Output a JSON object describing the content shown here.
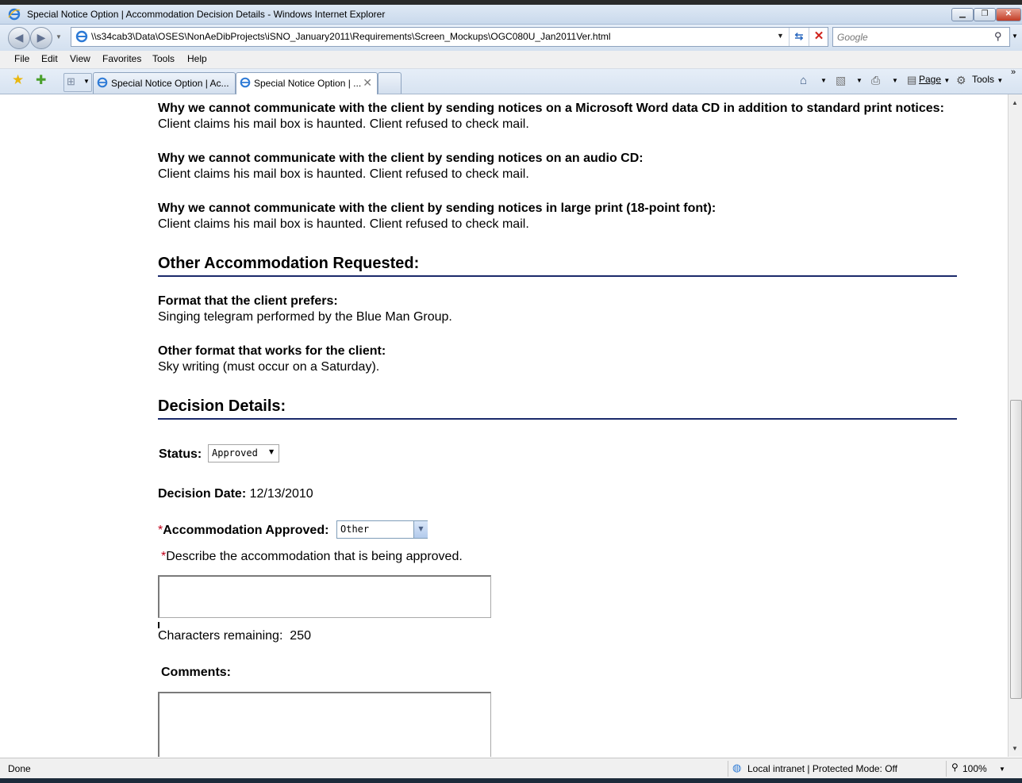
{
  "window": {
    "title": "Special Notice Option | Accommodation Decision Details - Windows Internet Explorer",
    "minimize_label": "▁",
    "restore_label": "❐",
    "close_label": "✕"
  },
  "address_bar": {
    "url": "\\\\s34cab3\\Data\\OSES\\NonAeDibProjects\\iSNO_January2011\\Requirements\\Screen_Mockups\\OGC080U_Jan2011Ver.html",
    "search_placeholder": "Google"
  },
  "menu": [
    "File",
    "Edit",
    "View",
    "Favorites",
    "Tools",
    "Help"
  ],
  "tabs": [
    {
      "label": "Special Notice Option | Ac..."
    },
    {
      "label": "Special Notice Option | ..."
    }
  ],
  "command_bar": {
    "page_label": "Page",
    "tools_label": "Tools"
  },
  "content": {
    "reasons": [
      {
        "question": "Why we cannot communicate with the client by sending notices on a Microsoft Word data CD in addition to standard print notices:",
        "answer": "Client claims his mail box is haunted. Client refused to check mail."
      },
      {
        "question": "Why we cannot communicate with the client by sending notices on an audio CD:",
        "answer": "Client claims his mail box is haunted. Client refused to check mail."
      },
      {
        "question": "Why we cannot communicate with the client by sending notices in large print (18-point font):",
        "answer": "Client claims his mail box is haunted. Client refused to check mail."
      }
    ],
    "other_accommodation": {
      "heading": "Other Accommodation Requested:",
      "preferred_label": "Format that the client prefers:",
      "preferred_value": "Singing telegram performed by the Blue Man Group.",
      "other_label": "Other format that works for the client:",
      "other_value": "Sky writing (must occur on a Saturday)."
    },
    "decision": {
      "heading": "Decision Details:",
      "status_label": "Status:",
      "status_value": "Approved",
      "date_label": "Decision Date:",
      "date_value": "12/13/2010",
      "required_marker": "*",
      "approved_label": "Accommodation Approved:",
      "approved_value": "Other",
      "describe_label": "Describe the accommodation that is being approved.",
      "chars_label": "Characters remaining:",
      "chars_value": "250",
      "comments_label": "Comments:"
    }
  },
  "status_bar": {
    "left": "Done",
    "zone": "Local intranet | Protected Mode: Off",
    "zoom": "100%"
  }
}
